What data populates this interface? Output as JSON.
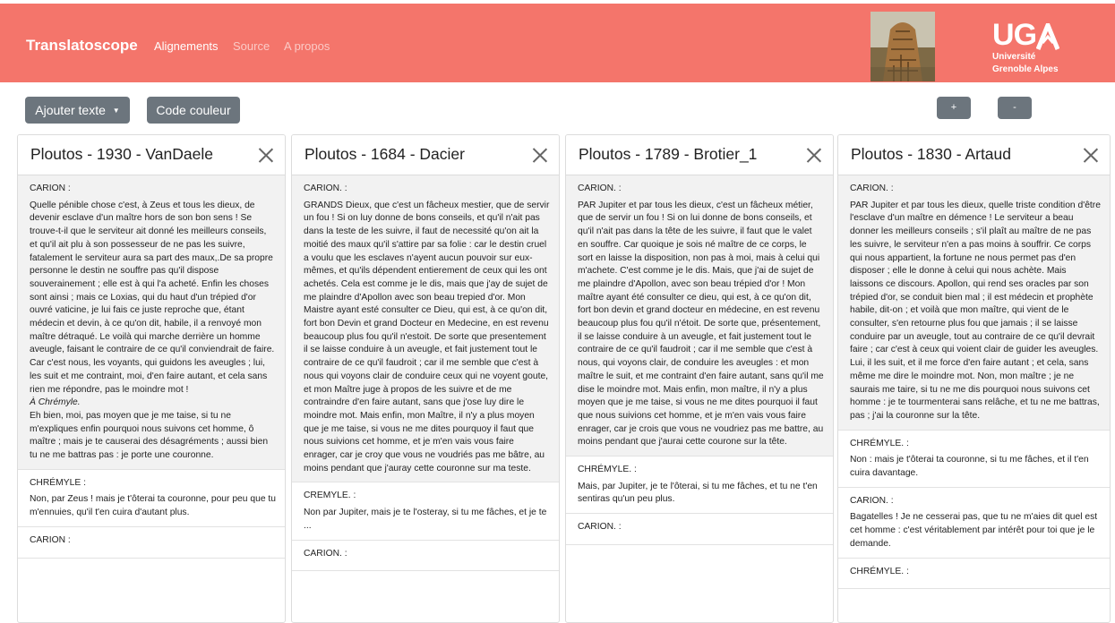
{
  "navbar": {
    "brand": "Translatoscope",
    "links": [
      "Alignements",
      "Source",
      "A propos"
    ],
    "logo_letters": [
      "U",
      "G",
      "A"
    ],
    "logo_line1": "Université",
    "logo_line2": "Grenoble Alpes",
    "color": "#f4756b"
  },
  "toolbar": {
    "add_text_label": "Ajouter texte",
    "color_code_label": "Code couleur",
    "zoom_in_label": "+",
    "zoom_out_label": "-"
  },
  "columns": [
    {
      "title": "Ploutos - 1930 - VanDaele",
      "segments": [
        {
          "speaker": "CARION :",
          "text": "Quelle pénible chose c'est, à Zeus et tous les dieux, de devenir esclave d'un maître hors de son bon sens ! Se trouve-t-il que le serviteur ait donné les meilleurs conseils, et qu'il ait plu à son possesseur de ne pas les suivre, fatalement le serviteur aura sa part des maux,.De sa propre personne le destin ne souffre pas qu'il dispose souverainement ; elle est à qui l'a acheté. Enfin les choses sont ainsi ; mais ce Loxias, qui du haut d'un trépied d'or ouvré vaticine, je lui fais ce juste reproche que, étant médecin et devin, à ce qu'on dit, habile, il a renvoyé mon maître détraqué. Le voilà qui marche derrière un homme aveugle, faisant le contraire de ce qu'il conviendrait de faire. Car c'est nous, les voyants, qui guidons les aveugles ; lui, les suit et me contraint, moi, d'en faire autant, et cela sans rien me répondre, pas le moindre mot !",
          "stage": "À Chrémyle.",
          "text2": "Eh bien, moi, pas moyen que je me taise, si tu ne m'expliques enfin pourquoi nous suivons cet homme, ô maître ; mais je te causerai des désagréments ; aussi bien tu ne me battras pas : je porte une couronne."
        },
        {
          "speaker": "CHRÉMYLE :",
          "text": "Non, par Zeus ! mais je t'ôterai ta couronne, pour peu que tu m'ennuies, qu'il t'en cuira d'autant plus."
        },
        {
          "speaker": "CARION :",
          "text": ""
        }
      ]
    },
    {
      "title": "Ploutos - 1684 - Dacier",
      "segments": [
        {
          "speaker": "CARION. :",
          "text": "GRANDS Dieux, que c'est un fâcheux mestier, que de servir un fou ! Si on luy donne de bons conseils, et qu'il n'ait pas dans la teste de les suivre, il faut de necessité qu'on ait la moitié des maux qu'il s'attire par sa folie : car le destin cruel a voulu que les esclaves n'ayent aucun pouvoir sur eux-mêmes, et qu'ils dépendent entierement de ceux qui les ont achetés. Cela est comme je le dis, mais que j'ay de sujet de me plaindre d'Apollon avec son beau trepied d'or. Mon Maistre ayant esté consulter ce Dieu, qui est, à ce qu'on dit, fort bon Devin et grand Docteur en Medecine, en est revenu beaucoup plus fou qu'il n'estoit. De sorte que presentement il se laisse conduire à un aveugle, et fait justement tout le contraire de ce qu'il faudroit ; car il me semble que c'est à nous qui voyons clair de conduire ceux qui ne voyent goute, et mon Maître juge à propos de les suivre et de me contraindre d'en faire autant, sans que j'ose luy dire le moindre mot. Mais enfin, mon Maître, il n'y a plus moyen que je me taise, si vous ne me dites pourquoy il faut que nous suivions cet homme, et je m'en vais vous faire enrager, car je croy que vous ne voudriés pas me bâtre, au moins pendant que j'auray cette couronne sur ma teste."
        },
        {
          "speaker": "CREMYLE. :",
          "text": "Non par Jupiter, mais je te l'osteray, si tu me fâches, et je te ..."
        },
        {
          "speaker": "CARION. :",
          "text": ""
        }
      ]
    },
    {
      "title": "Ploutos - 1789 - Brotier_1",
      "segments": [
        {
          "speaker": "CARION. :",
          "text": "PAR Jupiter et par tous les dieux, c'est un fâcheux métier, que de servir un fou ! Si on lui donne de bons conseils, et qu'il n'ait pas dans la tête de les suivre, il faut que le valet en souffre. Car quoique je sois né maître de ce corps, le sort en laisse la disposition, non pas à moi, mais à celui qui m'achete. C'est comme je le dis. Mais, que j'ai de sujet de me plaindre d'Apollon, avec son beau trépied d'or ! Mon maître ayant été consulter ce dieu, qui est, à ce qu'on dit, fort bon devin et grand docteur en médecine, en est revenu beaucoup plus fou qu'il n'étoit. De sorte que, présentement, il se laisse conduire à un aveugle, et fait justement tout le contraire de ce qu'il faudroit ; car il me semble que c'est à nous, qui voyons clair, de conduire les aveugles : et mon maître le suit, et me contraint d'en faire autant, sans qu'il me dise le moindre mot. Mais enfin, mon maître, il n'y a plus moyen que je me taise, si vous ne me dites pourquoi il faut que nous suivions cet homme, et je m'en vais vous faire enrager, car je crois que vous ne voudriez pas me battre, au moins pendant que j'aurai cette courone sur la tête."
        },
        {
          "speaker": "CHRÉMYLE. :",
          "text": "Mais, par Jupiter, je te l'ôterai, si tu me fâches, et tu ne t'en sentiras qu'un peu plus."
        },
        {
          "speaker": "CARION. :",
          "text": ""
        }
      ]
    },
    {
      "title": "Ploutos - 1830 - Artaud",
      "segments": [
        {
          "speaker": "CARION. :",
          "text": "PAR Jupiter et par tous les dieux, quelle triste condition d'être l'esclave d'un maître en démence ! Le serviteur a beau donner les meilleurs conseils ; s'il plaît au maître de ne pas les suivre, le serviteur n'en a pas moins à souffrir. Ce corps qui nous appartient, la fortune ne nous permet pas d'en disposer ; elle le donne à celui qui nous achète. Mais laissons ce discours. Apollon, qui rend ses oracles par son trépied d'or, se conduit bien mal ; il est médecin et prophète habile, dit-on ; et voilà que mon maître, qui vient de le consulter, s'en retourne plus fou que jamais ; il se laisse conduire par un aveugle, tout au contraire de ce qu'il devrait faire ; car c'est à ceux qui voient clair de guider les aveugles. Lui, il les suit, et il me force d'en faire autant ; et cela, sans même me dire le moindre mot. Non, mon maître ; je ne saurais me taire, si tu ne me dis pourquoi nous suivons cet homme : je te tourmenterai sans relâche, et tu ne me battras, pas ; j'ai la couronne sur la tête."
        },
        {
          "speaker": "CHRÉMYLE. :",
          "text": "Non : mais je t'ôterai ta couronne, si tu me fâches, et il t'en cuira davantage."
        },
        {
          "speaker": "CARION. :",
          "text": "Bagatelles ! Je ne cesserai pas, que tu ne m'aies dit quel est cet homme : c'est véritablement par intérêt pour toi que je le demande."
        },
        {
          "speaker": "CHRÉMYLE. :",
          "text": ""
        }
      ]
    }
  ]
}
